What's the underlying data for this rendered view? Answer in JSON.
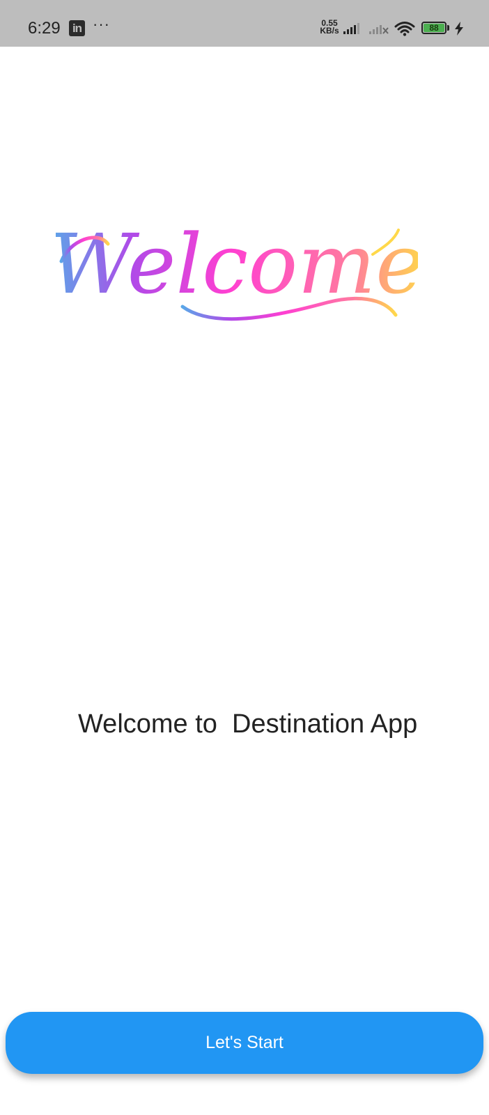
{
  "status_bar": {
    "time": "6:29",
    "app_icon": "linkedin-icon",
    "more": "···",
    "net_speed_value": "0.55",
    "net_speed_unit": "KB/s",
    "battery_level": "88",
    "icons": [
      "signal-icon",
      "signal-off-icon",
      "wifi-icon",
      "battery-icon",
      "charging-bolt-icon"
    ]
  },
  "logo": {
    "text": "Welcome",
    "gradient": [
      "#5aa7e8",
      "#b04ae8",
      "#ff3fd1",
      "#ff7aa0",
      "#ffd84a"
    ]
  },
  "main": {
    "heading": "Welcome to  Destination App"
  },
  "actions": {
    "start_label": "Let's Start",
    "button_color": "#2196f3"
  }
}
